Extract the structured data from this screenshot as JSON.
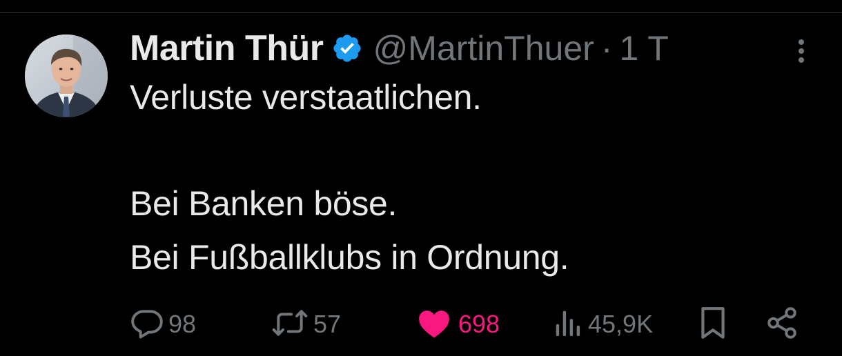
{
  "tweet": {
    "display_name": "Martin Thür",
    "handle": "@MartinThuer",
    "separator": "·",
    "time": "1 T",
    "verified": true,
    "lines": [
      "Verluste verstaatlichen.",
      "Bei Banken böse.",
      "Bei Fußballklubs in Ordnung."
    ],
    "actions": {
      "replies": "98",
      "reposts": "57",
      "likes": "698",
      "liked": true,
      "views": "45,9K"
    }
  },
  "colors": {
    "background": "#000000",
    "text": "#e7e9ea",
    "muted": "#71767b",
    "verified": "#1d9bf0",
    "like": "#f91880"
  },
  "icons": [
    "avatar",
    "verified-badge-icon",
    "more-icon",
    "reply-icon",
    "repost-icon",
    "heart-icon",
    "views-icon",
    "bookmark-icon",
    "share-icon"
  ]
}
